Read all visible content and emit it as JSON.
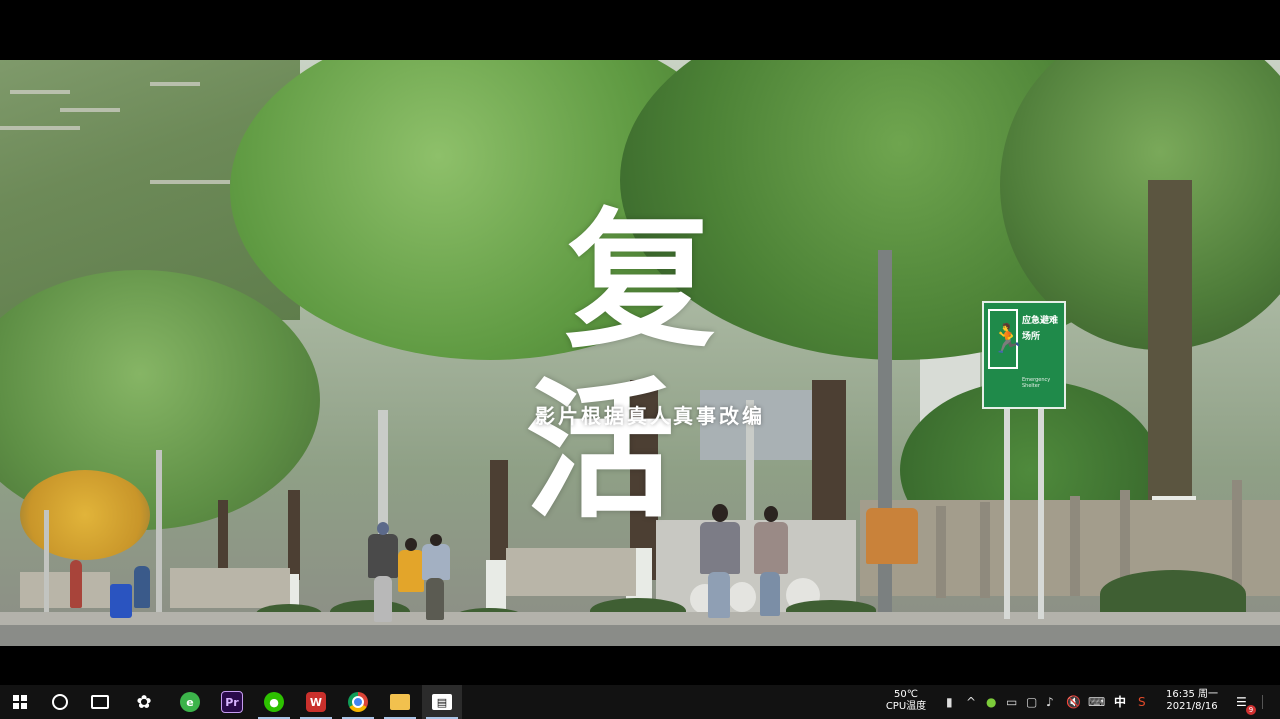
{
  "video": {
    "title": "复 活",
    "subtitle": "影片根据真人真事改编"
  },
  "sign": {
    "text": "应急避难场所",
    "english": "Emergency Shelter"
  },
  "taskbar": {
    "start_icon": "windows-logo-icon",
    "apps": [
      {
        "name": "cortana-search",
        "icon": "circle-icon"
      },
      {
        "name": "task-view",
        "icon": "task-view-icon"
      },
      {
        "name": "pinwheel-app",
        "icon": "pinwheel-icon"
      },
      {
        "name": "360-browser",
        "icon": "globe-icon"
      },
      {
        "name": "premiere-pro",
        "label": "Pr"
      },
      {
        "name": "wechat",
        "icon": "wechat-icon"
      },
      {
        "name": "wps-office",
        "label": "W"
      },
      {
        "name": "chrome",
        "icon": "chrome-icon"
      },
      {
        "name": "file-explorer",
        "icon": "folder-icon"
      },
      {
        "name": "video-player",
        "icon": "clapperboard-icon"
      }
    ],
    "tray": {
      "cpu_temp": "50℃",
      "cpu_label": "CPU温度",
      "ime_label": "中",
      "time": "16:35 周一",
      "date": "2021/8/16",
      "notification_count": "9"
    }
  },
  "colors": {
    "taskbar_bg": "#121212",
    "sign_green": "#1f8a4a",
    "premiere_purple": "#2a0a4a",
    "wps_red": "#c9302c"
  }
}
